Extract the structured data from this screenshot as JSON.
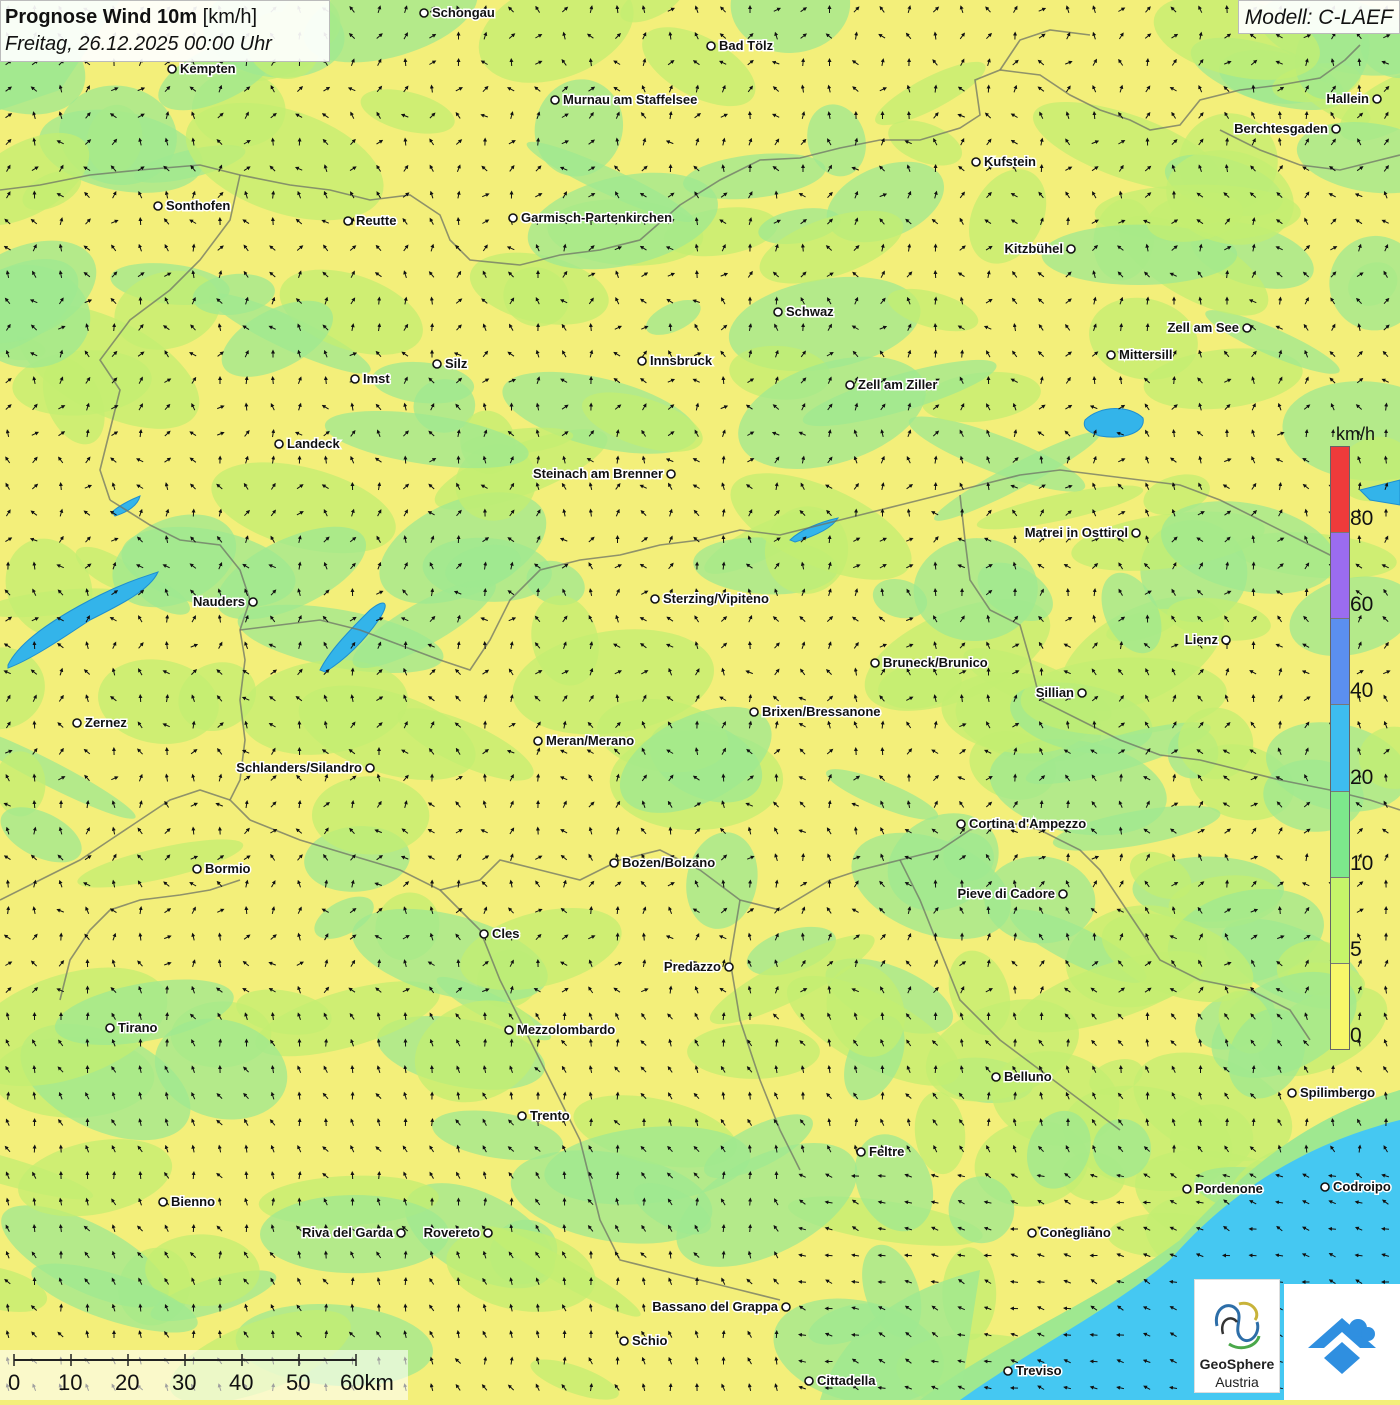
{
  "header": {
    "title_bold": "Prognose Wind 10m",
    "title_unit": "[km/h]",
    "datetime": "Freitag, 26.12.2025 00:00 Uhr",
    "model": "Modell: C-LAEF"
  },
  "legend": {
    "unit": "km/h",
    "labels": [
      "80",
      "60",
      "40",
      "20",
      "10",
      "5",
      "0"
    ],
    "colors": [
      "#ef3b3b",
      "#9b6cf0",
      "#5b8ff0",
      "#3dbdf0",
      "#7de88c",
      "#c6f56a",
      "#f7f76a"
    ]
  },
  "scale_bar": {
    "labels": [
      "0",
      "10",
      "20",
      "30",
      "40",
      "50",
      "60km"
    ]
  },
  "logos": {
    "geosphere_line1": "GeoSphere",
    "geosphere_line2": "Austria"
  },
  "cities": [
    {
      "name": "Schongau",
      "label_side": "right"
    },
    {
      "name": "Bad Tölz",
      "label_side": "right"
    },
    {
      "name": "Kempten",
      "label_side": "right"
    },
    {
      "name": "Murnau am Staffelsee",
      "label_side": "right"
    },
    {
      "name": "Hallein",
      "label_side": "left"
    },
    {
      "name": "Berchtesgaden",
      "label_side": "left"
    },
    {
      "name": "Kufstein",
      "label_side": "right"
    },
    {
      "name": "Sonthofen",
      "label_side": "right"
    },
    {
      "name": "Reutte",
      "label_side": "right"
    },
    {
      "name": "Garmisch-Partenkirchen",
      "label_side": "right"
    },
    {
      "name": "Kitzbühel",
      "label_side": "left"
    },
    {
      "name": "Schwaz",
      "label_side": "right"
    },
    {
      "name": "Zell am See",
      "label_side": "left"
    },
    {
      "name": "Mittersill",
      "label_side": "right"
    },
    {
      "name": "Silz",
      "label_side": "right"
    },
    {
      "name": "Innsbruck",
      "label_side": "right"
    },
    {
      "name": "Imst",
      "label_side": "right"
    },
    {
      "name": "Zell am Ziller",
      "label_side": "right"
    },
    {
      "name": "Landeck",
      "label_side": "right"
    },
    {
      "name": "Steinach am Brenner",
      "label_side": "left"
    },
    {
      "name": "Matrei in Osttirol",
      "label_side": "left"
    },
    {
      "name": "Nauders",
      "label_side": "left"
    },
    {
      "name": "Sterzing/Vipiteno",
      "label_side": "right"
    },
    {
      "name": "Lienz",
      "label_side": "left"
    },
    {
      "name": "Bruneck/Brunico",
      "label_side": "right"
    },
    {
      "name": "Sillian",
      "label_side": "left"
    },
    {
      "name": "Brixen/Bressanone",
      "label_side": "right"
    },
    {
      "name": "Zernez",
      "label_side": "right"
    },
    {
      "name": "Meran/Merano",
      "label_side": "right"
    },
    {
      "name": "Schlanders/Silandro",
      "label_side": "left"
    },
    {
      "name": "Cortina d'Ampezzo",
      "label_side": "right"
    },
    {
      "name": "Bozen/Bolzano",
      "label_side": "right"
    },
    {
      "name": "Bormio",
      "label_side": "right"
    },
    {
      "name": "Pieve di Cadore",
      "label_side": "left"
    },
    {
      "name": "Cles",
      "label_side": "right"
    },
    {
      "name": "Predazzo",
      "label_side": "left"
    },
    {
      "name": "Tirano",
      "label_side": "right"
    },
    {
      "name": "Mezzolombardo",
      "label_side": "right"
    },
    {
      "name": "Belluno",
      "label_side": "right"
    },
    {
      "name": "Spilimbergo",
      "label_side": "right"
    },
    {
      "name": "Trento",
      "label_side": "right"
    },
    {
      "name": "Feltre",
      "label_side": "right"
    },
    {
      "name": "Pordenone",
      "label_side": "right"
    },
    {
      "name": "Codroipo",
      "label_side": "right"
    },
    {
      "name": "Bienno",
      "label_side": "right"
    },
    {
      "name": "Riva del Garda",
      "label_side": "left"
    },
    {
      "name": "Rovereto",
      "label_side": "left"
    },
    {
      "name": "Conegliano",
      "label_side": "right"
    },
    {
      "name": "Bassano del Grappa",
      "label_side": "left"
    },
    {
      "name": "Schio",
      "label_side": "right"
    },
    {
      "name": "Treviso",
      "label_side": "right"
    },
    {
      "name": "Cittadella",
      "label_side": "right"
    }
  ]
}
